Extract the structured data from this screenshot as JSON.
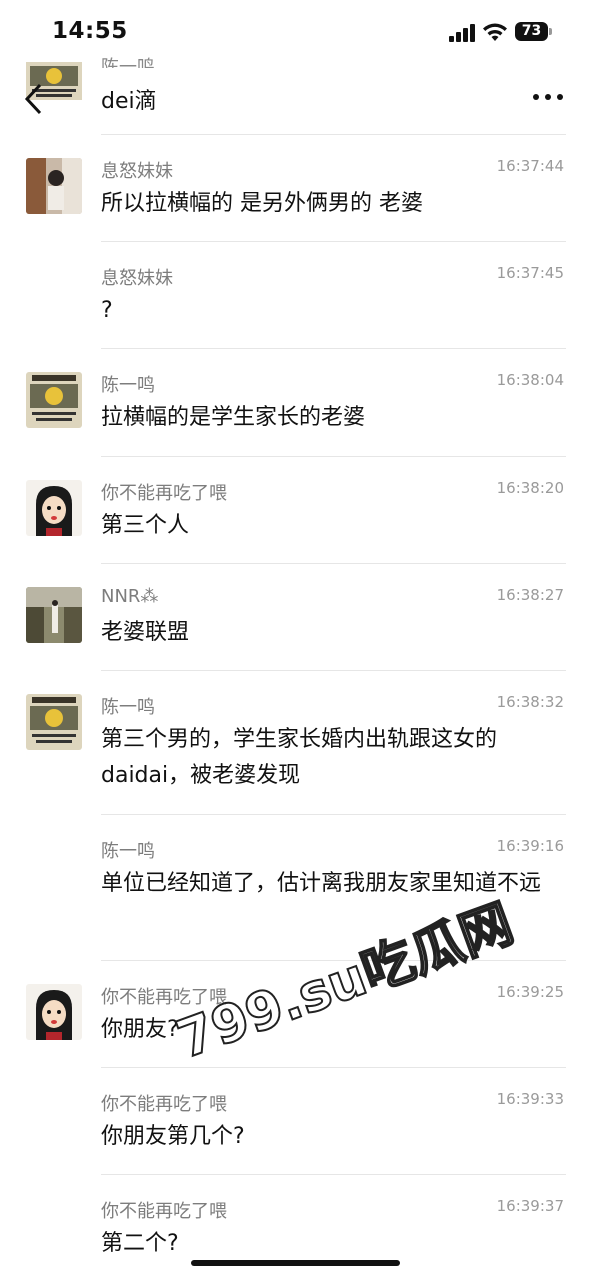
{
  "status_bar": {
    "time": "14:55",
    "battery": "73"
  },
  "header": {
    "sender_partial": "陈一鸣",
    "text": "dei滴"
  },
  "messages": [
    {
      "sender": "息怒妹妹",
      "time": "16:37:44",
      "text": "所以拉横幅的 是另外俩男的 老婆",
      "avatar": "photo-girl"
    },
    {
      "sender": "息怒妹妹",
      "time": "16:37:45",
      "text": "?"
    },
    {
      "sender": "陈一鸣",
      "time": "16:38:04",
      "text": "拉横幅的是学生家长的老婆",
      "avatar": "wanted-poster"
    },
    {
      "sender": "你不能再吃了喂",
      "time": "16:38:20",
      "text": "第三个人",
      "avatar": "cartoon-face"
    },
    {
      "sender": "NNR⁂",
      "time": "16:38:27",
      "text": "老婆联盟",
      "avatar": "photo-scene"
    },
    {
      "sender": "陈一鸣",
      "time": "16:38:32",
      "text": "第三个男的，学生家长婚内出轨跟这女的daidai，被老婆发现",
      "avatar": "wanted-poster"
    },
    {
      "sender": "陈一鸣",
      "time": "16:39:16",
      "text": "单位已经知道了，估计离我朋友家里知道不远"
    },
    {
      "sender": "你不能再吃了喂",
      "time": "16:39:25",
      "text": "你朋友?",
      "avatar": "cartoon-face"
    },
    {
      "sender": "你不能再吃了喂",
      "time": "16:39:33",
      "text": "你朋友第几个?"
    },
    {
      "sender": "你不能再吃了喂",
      "time": "16:39:37",
      "text": "第二个?"
    }
  ],
  "watermark": "799.su吃瓜网"
}
